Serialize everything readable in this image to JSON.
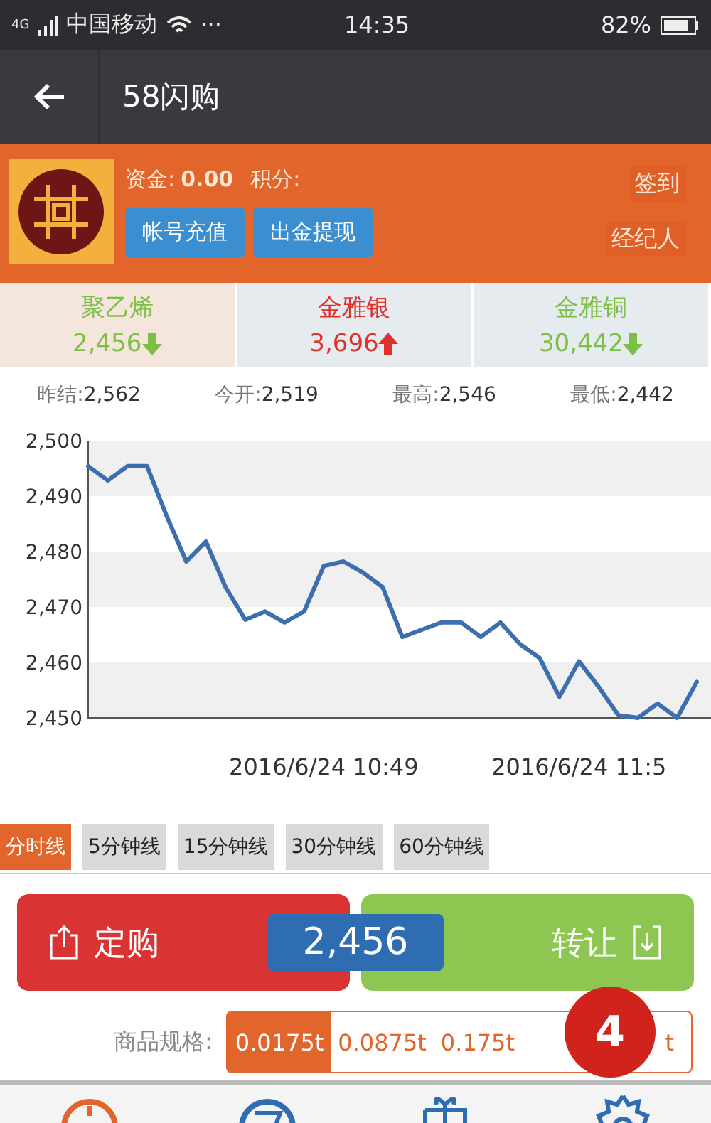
{
  "status_bar": {
    "network": "4G",
    "carrier": "中国移动",
    "dots": "···",
    "time": "14:35",
    "battery": "82%"
  },
  "nav": {
    "title": "58闪购"
  },
  "account": {
    "funds_label": "资金:",
    "funds": "0.00",
    "points_label": "积分:",
    "buttons": [
      "帐号充值",
      "出金提现"
    ],
    "links": [
      "签到",
      "经纪人"
    ]
  },
  "tickers": [
    {
      "name": "聚乙烯",
      "price": "2,456",
      "kind": "falling",
      "selected": true
    },
    {
      "name": "金雅银",
      "price": "3,696",
      "kind": "rising",
      "selected": false
    },
    {
      "name": "金雅铜",
      "price": "30,442",
      "kind": "falling",
      "selected": false
    }
  ],
  "stats": [
    {
      "label": "昨结:",
      "value": "2,562"
    },
    {
      "label": "今开:",
      "value": "2,519"
    },
    {
      "label": "最高:",
      "value": "2,546"
    },
    {
      "label": "最低:",
      "value": "2,442"
    }
  ],
  "chart_data": {
    "type": "line",
    "categories": [
      null,
      null,
      null,
      null,
      null,
      null,
      null,
      null,
      null,
      null,
      null,
      null,
      "2016/6/24 10:49",
      null,
      null,
      null,
      null,
      null,
      null,
      null,
      null,
      null,
      null,
      null,
      null,
      "2016/6/24 11:5",
      null,
      null,
      null,
      null,
      null,
      null
    ],
    "series": [
      {
        "color": "#3d6fae",
        "values": [
          2495.4,
          2492.8,
          2495.4,
          2495.4,
          2486.4,
          2478.2,
          2481.8,
          2473.6,
          2467.7,
          2469.2,
          2467.2,
          2469.2,
          2477.4,
          2478.2,
          2476.2,
          2473.6,
          2464.6,
          2465.9,
          2467.2,
          2467.2,
          2464.6,
          2467.2,
          2463.3,
          2460.8,
          2453.8,
          2460.2,
          2455.6,
          2450.5,
          2450,
          2452.6,
          2450,
          2456.5
        ]
      }
    ],
    "ylim": [
      2450,
      2500
    ],
    "yticks": [
      {
        "value": 2500,
        "label": "2,500"
      },
      {
        "value": 2490,
        "label": "2,490"
      },
      {
        "value": 2480,
        "label": "2,480"
      },
      {
        "value": 2470,
        "label": "2,470"
      },
      {
        "value": 2460,
        "label": "2,460"
      },
      {
        "value": 2450,
        "label": "2,450"
      }
    ]
  },
  "periods": [
    {
      "label": "分时线",
      "selected": true
    },
    {
      "label": "5分钟线",
      "selected": false
    },
    {
      "label": "15分钟线",
      "selected": false
    },
    {
      "label": "30分钟线",
      "selected": false
    },
    {
      "label": "60分钟线",
      "selected": false
    }
  ],
  "trade": {
    "buy": "定购",
    "price": "2,456",
    "sell": "转让"
  },
  "spec": {
    "label": "商品规格:",
    "options": [
      {
        "label": "0.0175t",
        "selected": true
      },
      {
        "label": "0.0875t",
        "selected": false
      },
      {
        "label": "0.175t",
        "selected": false
      },
      {
        "label": "t",
        "selected": false
      }
    ]
  },
  "badge": "4"
}
